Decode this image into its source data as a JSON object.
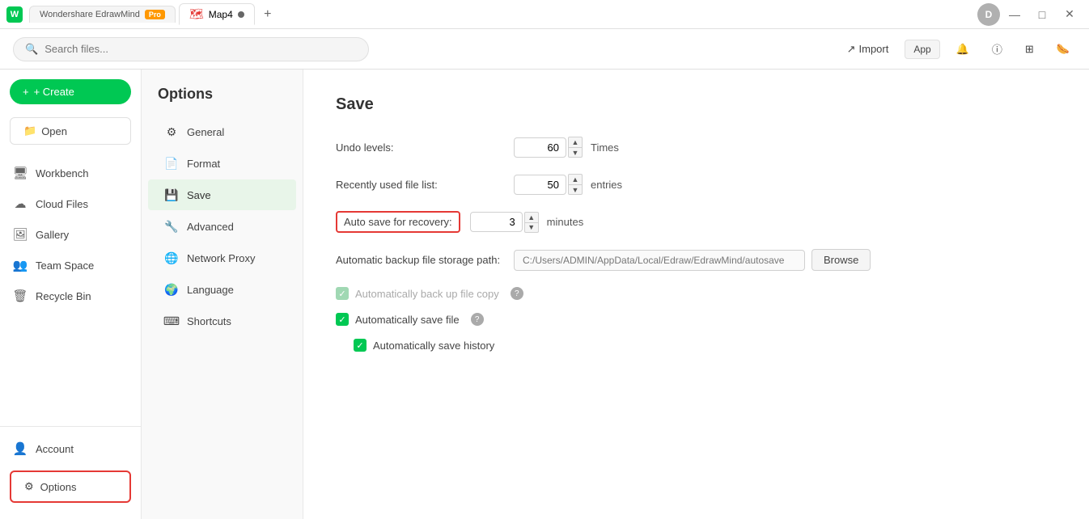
{
  "titleBar": {
    "appName": "Wondershare EdrawMind",
    "badge": "Pro",
    "tabs": [
      {
        "id": "home",
        "label": "Wondershare EdrawMind",
        "active": false
      },
      {
        "id": "map4",
        "label": "Map4",
        "active": true,
        "dot": true
      }
    ],
    "addTab": "+",
    "avatar": "D",
    "windowBtns": {
      "minimize": "—",
      "maximize": "□",
      "close": "✕"
    }
  },
  "toolbar": {
    "searchPlaceholder": "Search files...",
    "importLabel": "Import",
    "appLabel": "App"
  },
  "sidebar": {
    "createLabel": "+ Create",
    "openLabel": "Open",
    "items": [
      {
        "id": "workbench",
        "label": "Workbench",
        "icon": "🖥"
      },
      {
        "id": "cloud-files",
        "label": "Cloud Files",
        "icon": "☁"
      },
      {
        "id": "gallery",
        "label": "Gallery",
        "icon": "🖼"
      },
      {
        "id": "team-space",
        "label": "Team Space",
        "icon": "👥"
      },
      {
        "id": "recycle-bin",
        "label": "Recycle Bin",
        "icon": "🗑"
      }
    ],
    "accountLabel": "Account",
    "optionsLabel": "Options"
  },
  "optionsPanel": {
    "title": "Options",
    "items": [
      {
        "id": "general",
        "label": "General",
        "icon": "⚙",
        "active": false
      },
      {
        "id": "format",
        "label": "Format",
        "icon": "📄",
        "active": false
      },
      {
        "id": "save",
        "label": "Save",
        "icon": "💾",
        "active": true
      },
      {
        "id": "advanced",
        "label": "Advanced",
        "icon": "🔧",
        "active": false
      },
      {
        "id": "network-proxy",
        "label": "Network Proxy",
        "icon": "🌐",
        "active": false
      },
      {
        "id": "language",
        "label": "Language",
        "icon": "🌍",
        "active": false
      },
      {
        "id": "shortcuts",
        "label": "Shortcuts",
        "icon": "⌨",
        "active": false
      }
    ]
  },
  "content": {
    "title": "Save",
    "fields": {
      "undoLabel": "Undo levels:",
      "undoValue": "60",
      "undoUnit": "Times",
      "recentLabel": "Recently used file list:",
      "recentValue": "50",
      "recentUnit": "entries",
      "autoSaveLabel": "Auto save for recovery:",
      "autoSaveValue": "3",
      "autoSaveUnit": "minutes",
      "backupPathLabel": "Automatic backup file storage path:",
      "backupPath": "C:/Users/ADMIN/AppData/Local/Edraw/EdrawMind/autosave",
      "browseLabel": "Browse"
    },
    "checkboxes": {
      "backupCopy": "Automatically back up file copy",
      "autoSave": "Automatically save file",
      "saveHistory": "Automatically save history"
    }
  }
}
